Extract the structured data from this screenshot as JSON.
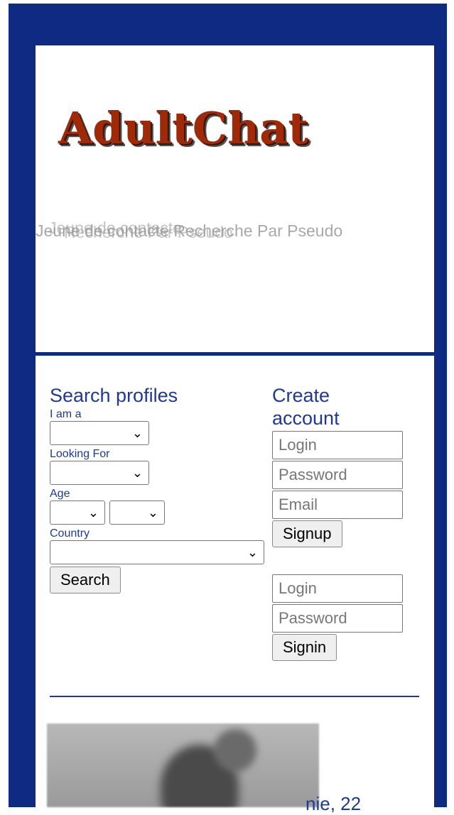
{
  "header": {
    "logo_text": "AdultChat",
    "tagline_layers": [
      "Jeune de contacte",
      "Recherche Par Pseudo",
      "Jeune de contacte Recherche Par Pseudo"
    ]
  },
  "search": {
    "title": "Search profiles",
    "i_am_label": "I am a",
    "looking_for_label": "Looking For",
    "age_label": "Age",
    "country_label": "Country",
    "i_am_value": "",
    "looking_for_value": "",
    "age_min_value": "",
    "age_max_value": "",
    "country_value": "",
    "search_button": "Search"
  },
  "create_account": {
    "title_line1": "Create",
    "title_line2": "account",
    "login_placeholder": "Login",
    "password_placeholder": "Password",
    "email_placeholder": "Email",
    "signup_button": "Signup"
  },
  "signin": {
    "login_placeholder": "Login",
    "password_placeholder": "Password",
    "signin_button": "Signin"
  },
  "profile_preview": {
    "caption": "nie, 22"
  },
  "colors": {
    "frame": "#0e2a82",
    "accent": "#1f3a8f",
    "logo": "#a02a08"
  }
}
